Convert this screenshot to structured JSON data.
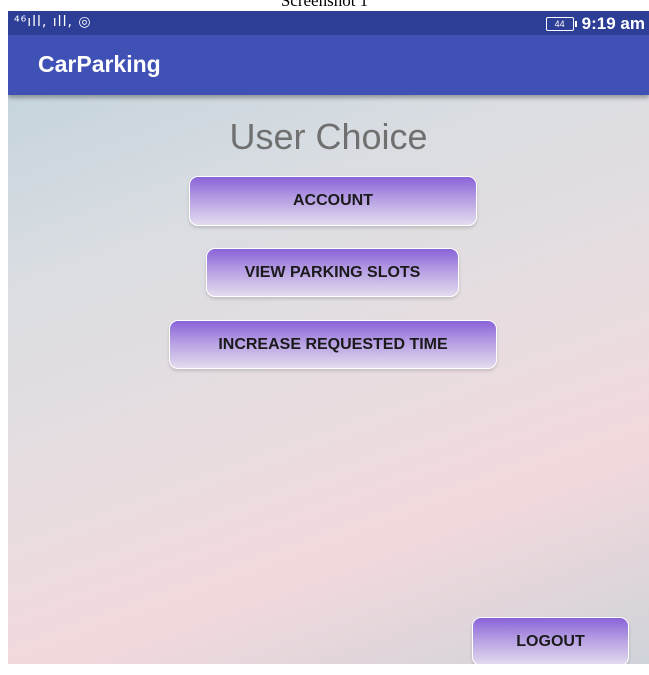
{
  "caption": "Screenshot 1",
  "status_bar": {
    "signal_text": "⁴⁶ıll, ıll, ◎",
    "battery": "44",
    "time": "9:19 am"
  },
  "app_bar": {
    "title": "CarParking"
  },
  "main": {
    "heading": "User Choice",
    "buttons": {
      "account": "ACCOUNT",
      "view_parking_slots": "VIEW PARKING SLOTS",
      "increase_requested_time": "INCREASE REQUESTED TIME"
    },
    "logout": "LOGOUT"
  },
  "colors": {
    "status_bar": "#2c3e96",
    "app_bar": "#3f51b5",
    "button_top": "#8a63d8",
    "button_bottom": "#e4dcee"
  },
  "icons": [
    "signal-icon",
    "wifi-hotspot-icon",
    "battery-icon"
  ]
}
